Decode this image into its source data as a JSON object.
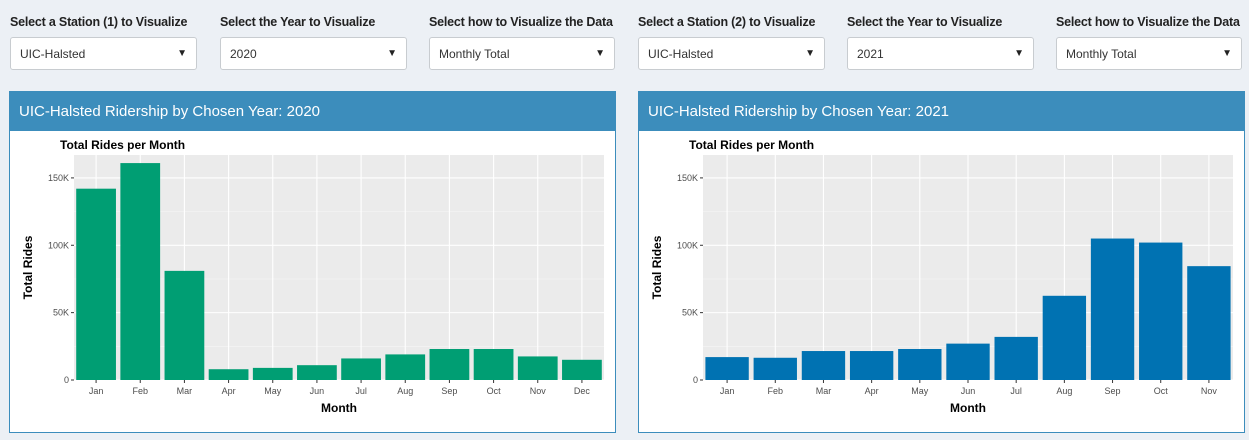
{
  "controls": [
    {
      "label": "Select a Station (1) to Visualize",
      "value": "UIC-Halsted"
    },
    {
      "label": "Select the Year to Visualize",
      "value": "2020"
    },
    {
      "label": "Select how to Visualize the Data",
      "value": "Monthly Total"
    },
    {
      "label": "Select a Station (2) to Visualize",
      "value": "UIC-Halsted"
    },
    {
      "label": "Select the Year to Visualize",
      "value": "2021"
    },
    {
      "label": "Select how to Visualize the Data",
      "value": "Monthly Total"
    }
  ],
  "icons": {
    "caret": "▼",
    "caret_name": "caret-down-icon"
  },
  "panels": [
    {
      "title": "UIC-Halsted Ridership by Chosen Year: 2020"
    },
    {
      "title": "UIC-Halsted Ridership by Chosen Year: 2021"
    }
  ],
  "colors": {
    "header": "#3c8dbc",
    "series1": "#009e73",
    "series2": "#0072b2",
    "plot_bg": "#ebebeb"
  },
  "chart_data": [
    {
      "type": "bar",
      "title": "Total Rides per Month",
      "xlabel": "Month",
      "ylabel": "Total Rides",
      "categories": [
        "Jan",
        "Feb",
        "Mar",
        "Apr",
        "May",
        "Jun",
        "Jul",
        "Aug",
        "Sep",
        "Oct",
        "Nov",
        "Dec"
      ],
      "values": [
        142000,
        161000,
        81000,
        8000,
        9000,
        11000,
        16000,
        19000,
        23000,
        23000,
        17500,
        15000
      ],
      "ylim": [
        0,
        167000
      ],
      "yticks": [
        0,
        50000,
        100000,
        150000
      ],
      "yticklabels": [
        "0",
        "50K",
        "100K",
        "150K"
      ],
      "color": "#009e73",
      "grid": true
    },
    {
      "type": "bar",
      "title": "Total Rides per Month",
      "xlabel": "Month",
      "ylabel": "Total Rides",
      "categories": [
        "Jan",
        "Feb",
        "Mar",
        "Apr",
        "May",
        "Jun",
        "Jul",
        "Aug",
        "Sep",
        "Oct",
        "Nov"
      ],
      "values": [
        17000,
        16500,
        21500,
        21500,
        23000,
        27000,
        32000,
        62500,
        105000,
        102000,
        84500
      ],
      "ylim": [
        0,
        167000
      ],
      "yticks": [
        0,
        50000,
        100000,
        150000
      ],
      "yticklabels": [
        "0",
        "50K",
        "100K",
        "150K"
      ],
      "color": "#0072b2",
      "grid": true
    }
  ]
}
